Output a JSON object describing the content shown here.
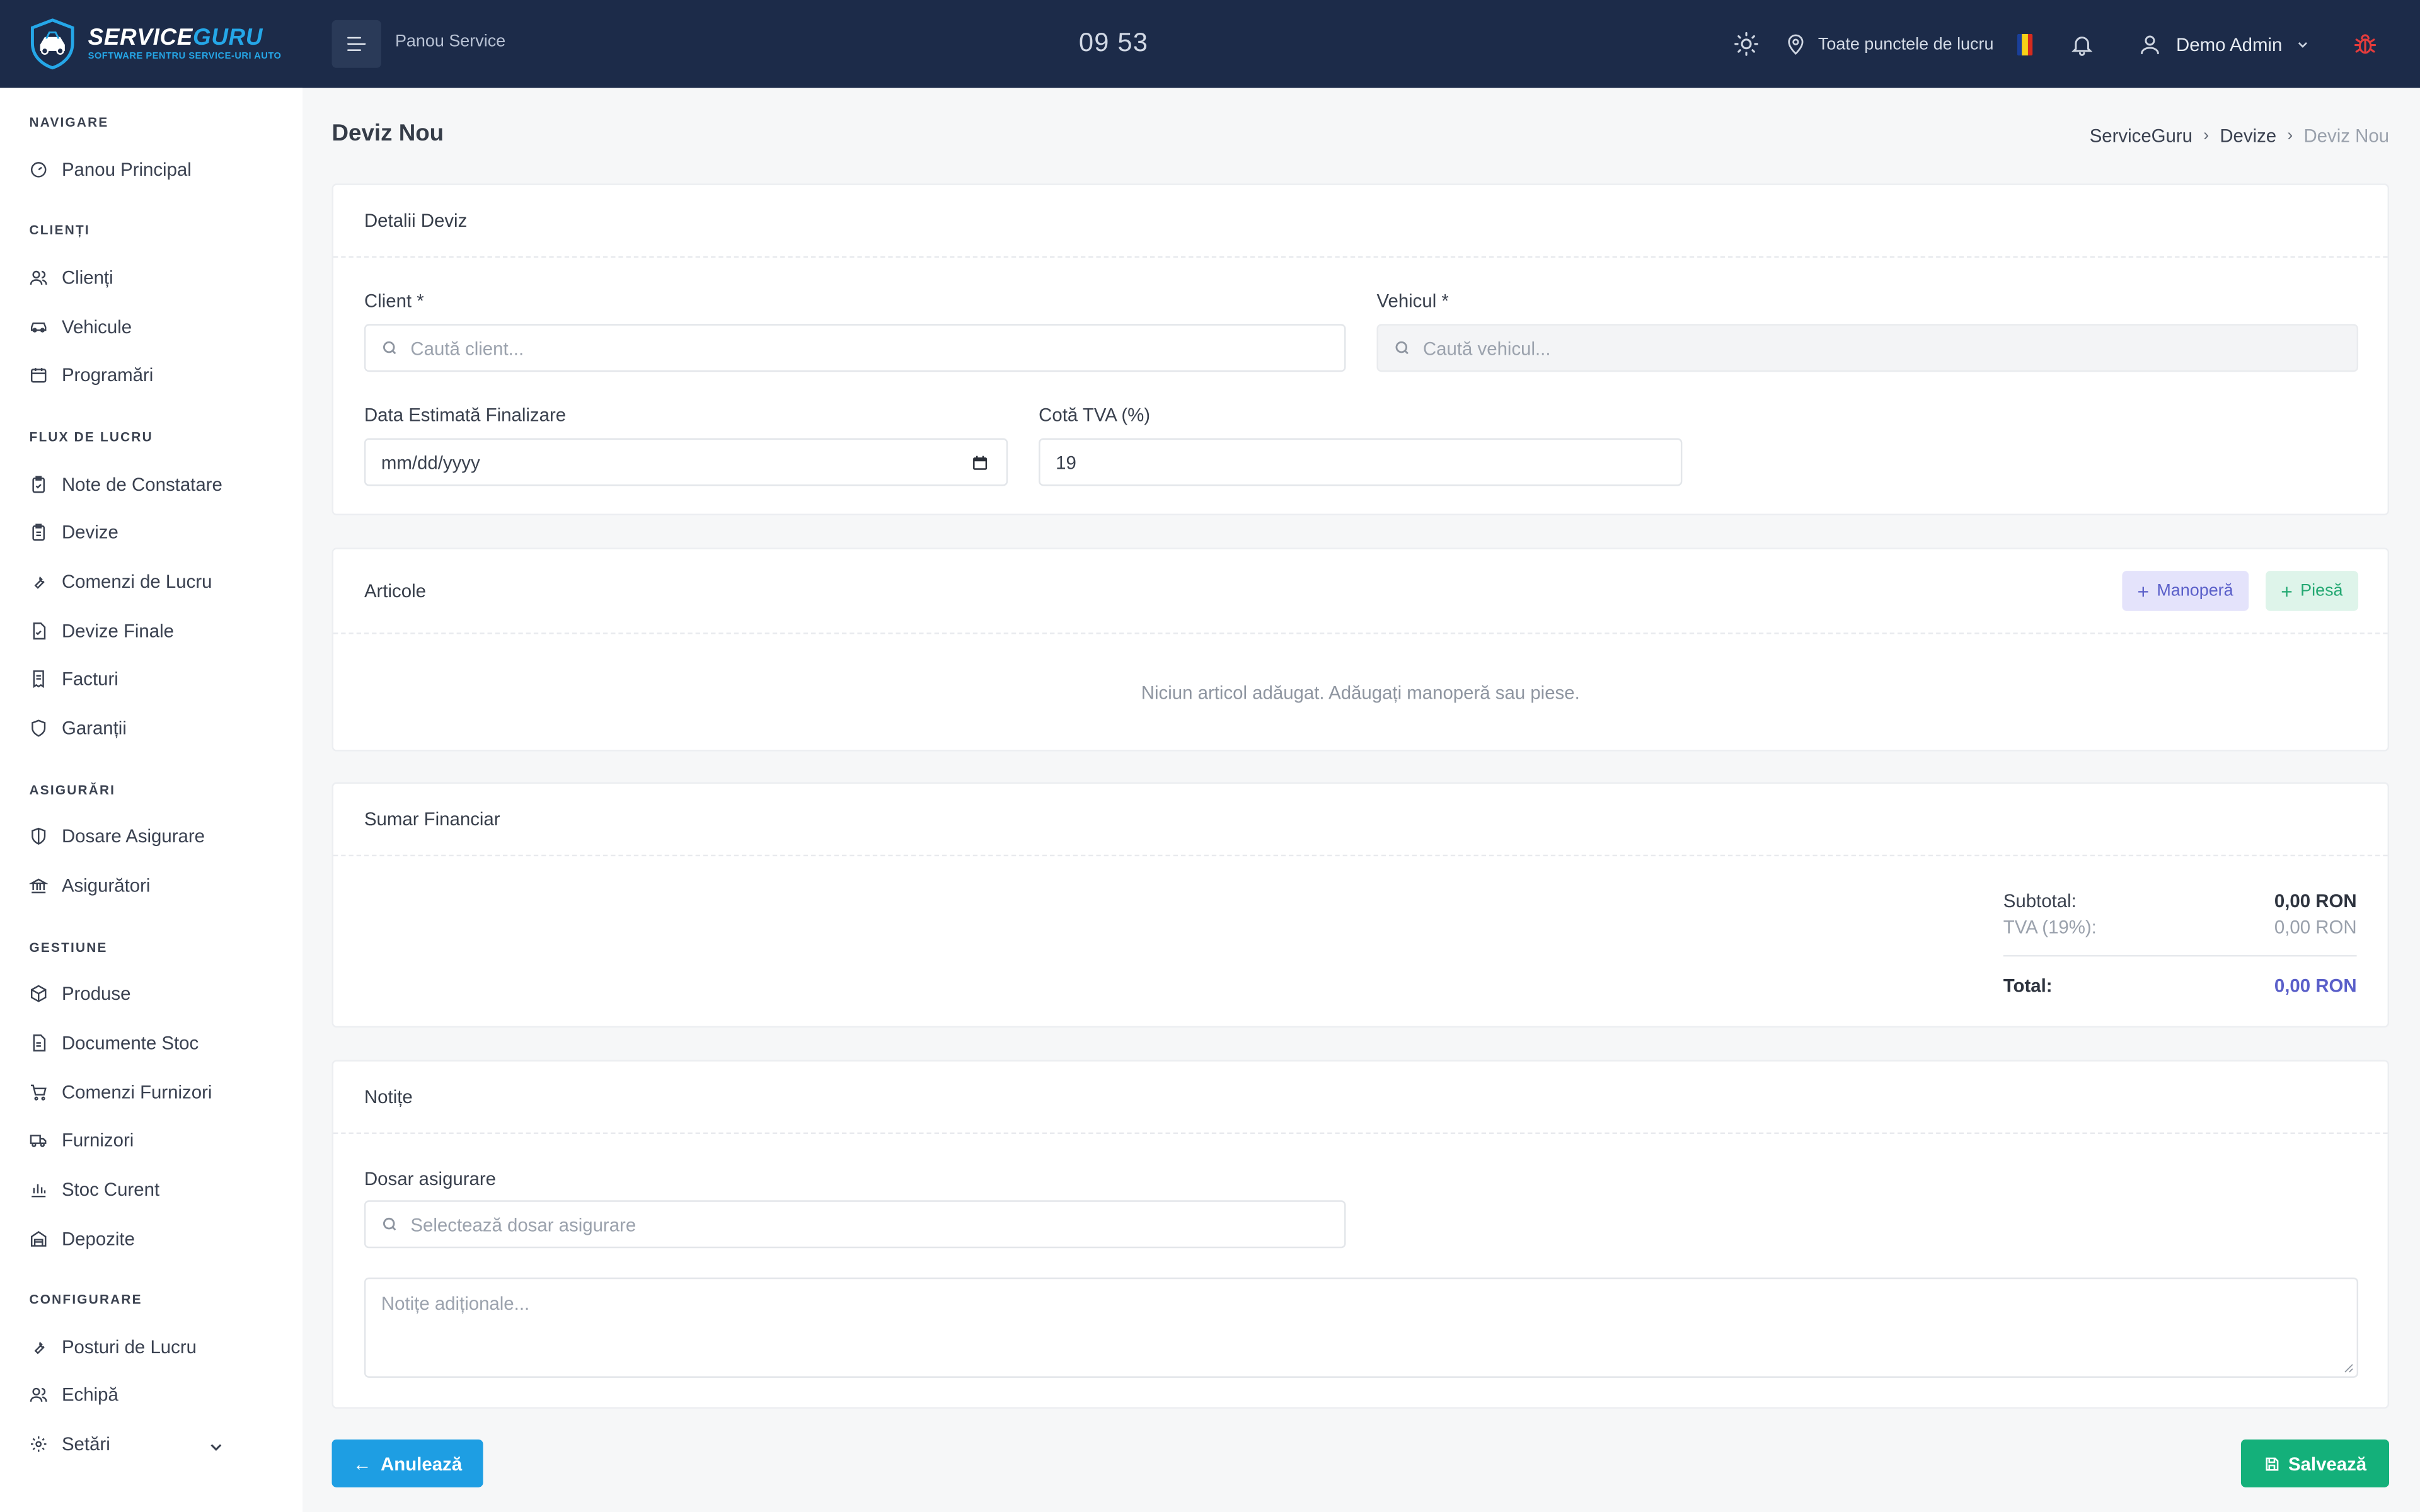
{
  "app": {
    "logo_title_a": "SERVICE",
    "logo_title_b": "GURU",
    "logo_subtitle": "SOFTWARE PENTRU SERVICE-URI AUTO",
    "panel_title": "Panou Service",
    "clock": "09 53",
    "location": "Toate punctele de lucru",
    "user": "Demo Admin",
    "colors": {
      "topbar": "#1c2b49",
      "accent": "#25a7e8",
      "primary_blue": "#1e9ee3",
      "save_green": "#14b07a",
      "total_purple": "#5a5fc9"
    }
  },
  "sidebar": {
    "sections": [
      {
        "title": "NAVIGARE",
        "items": [
          {
            "label": "Panou Principal",
            "icon": "dashboard-icon"
          }
        ]
      },
      {
        "title": "CLIENȚI",
        "items": [
          {
            "label": "Clienți",
            "icon": "users-icon"
          },
          {
            "label": "Vehicule",
            "icon": "car-icon"
          },
          {
            "label": "Programări",
            "icon": "calendar-icon"
          }
        ]
      },
      {
        "title": "FLUX DE LUCRU",
        "items": [
          {
            "label": "Note de Constatare",
            "icon": "clipboard-check-icon"
          },
          {
            "label": "Devize",
            "icon": "clipboard-icon"
          },
          {
            "label": "Comenzi de Lucru",
            "icon": "wrench-icon"
          },
          {
            "label": "Devize Finale",
            "icon": "file-check-icon"
          },
          {
            "label": "Facturi",
            "icon": "receipt-icon"
          },
          {
            "label": "Garanții",
            "icon": "shield-icon"
          }
        ]
      },
      {
        "title": "ASIGURĂRI",
        "items": [
          {
            "label": "Dosare Asigurare",
            "icon": "shield-half-icon"
          },
          {
            "label": "Asigurători",
            "icon": "bank-icon"
          }
        ]
      },
      {
        "title": "GESTIUNE",
        "items": [
          {
            "label": "Produse",
            "icon": "box-icon"
          },
          {
            "label": "Documente Stoc",
            "icon": "document-icon"
          },
          {
            "label": "Comenzi Furnizori",
            "icon": "cart-icon"
          },
          {
            "label": "Furnizori",
            "icon": "truck-icon"
          },
          {
            "label": "Stoc Curent",
            "icon": "bar-chart-icon"
          },
          {
            "label": "Depozite",
            "icon": "warehouse-icon"
          }
        ]
      },
      {
        "title": "CONFIGURARE",
        "items": [
          {
            "label": "Posturi de Lucru",
            "icon": "wrench-icon"
          },
          {
            "label": "Echipă",
            "icon": "team-icon"
          },
          {
            "label": "Setări",
            "icon": "gear-icon"
          }
        ]
      }
    ]
  },
  "page": {
    "title": "Deviz Nou",
    "breadcrumb": [
      "ServiceGuru",
      "Devize",
      "Deviz Nou"
    ]
  },
  "details": {
    "header": "Detalii Deviz",
    "client_label": "Client *",
    "client_placeholder": "Caută client...",
    "vehicle_label": "Vehicul *",
    "vehicle_placeholder": "Caută vehicul...",
    "date_label": "Data Estimată Finalizare",
    "date_value": "mm/dd/yyyy",
    "vat_label": "Cotă TVA (%)",
    "vat_value": "19"
  },
  "articles": {
    "header": "Articole",
    "add_labor": "Manoperă",
    "add_part": "Piesă",
    "empty": "Niciun articol adăugat. Adăugați manoperă sau piese."
  },
  "summary": {
    "header": "Sumar Financiar",
    "subtotal_label": "Subtotal:",
    "subtotal_value": "0,00 RON",
    "vat_label": "TVA (19%):",
    "vat_value": "0,00 RON",
    "total_label": "Total:",
    "total_value": "0,00 RON"
  },
  "notes": {
    "header": "Notițe",
    "insurance_label": "Dosar asigurare",
    "insurance_placeholder": "Selectează dosar asigurare",
    "notes_placeholder": "Notițe adiționale..."
  },
  "actions": {
    "cancel": "Anulează",
    "save": "Salvează"
  }
}
